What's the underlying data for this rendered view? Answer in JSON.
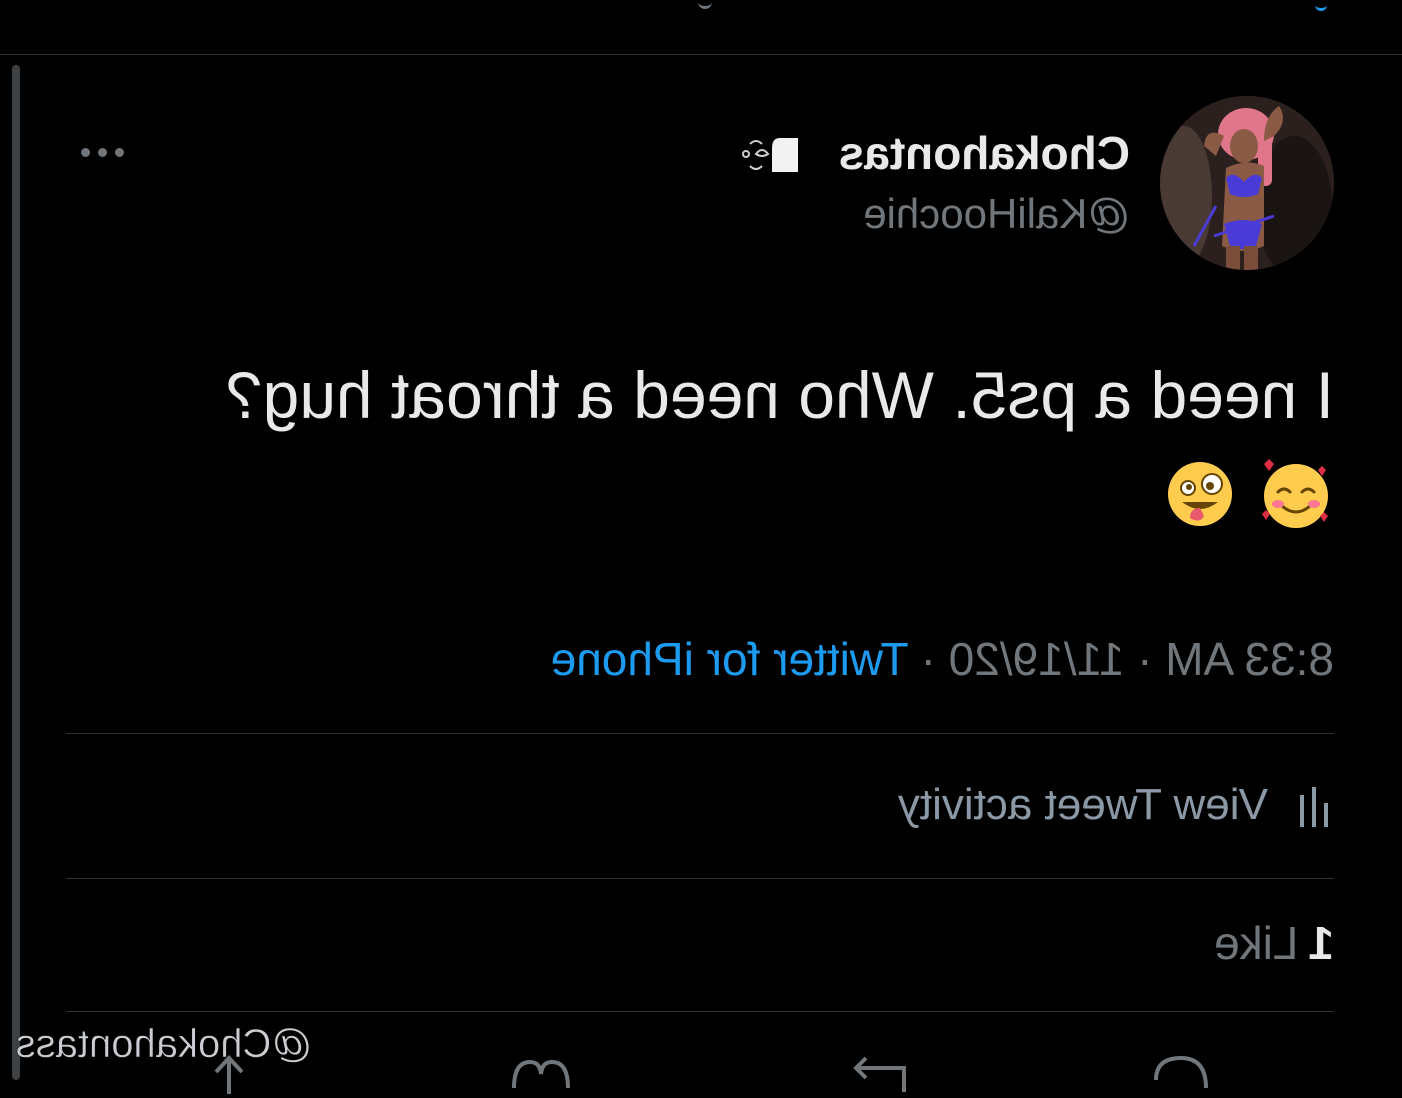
{
  "tweet": {
    "author": {
      "display_name": "Chokahontas",
      "handle": "@KaliHoochie",
      "name_emoji": "dash-icon"
    },
    "text": "I need a ps5. Who need a throat hug?",
    "emojis": [
      "smiling-face-with-hearts-icon",
      "zany-face-icon"
    ],
    "time": "8:33 AM",
    "separator": "·",
    "date": "11/19/20",
    "source": "Twitter for iPhone",
    "activity_label": "View Tweet activity",
    "likes": {
      "count": "1",
      "label": "Like"
    }
  },
  "watermark": "@Chokahontass",
  "colors": {
    "background": "#000000",
    "text": "#e7e9ea",
    "secondary": "#71767b",
    "accent": "#1d9bf0",
    "divider": "#2f3336"
  },
  "mirrored": true
}
